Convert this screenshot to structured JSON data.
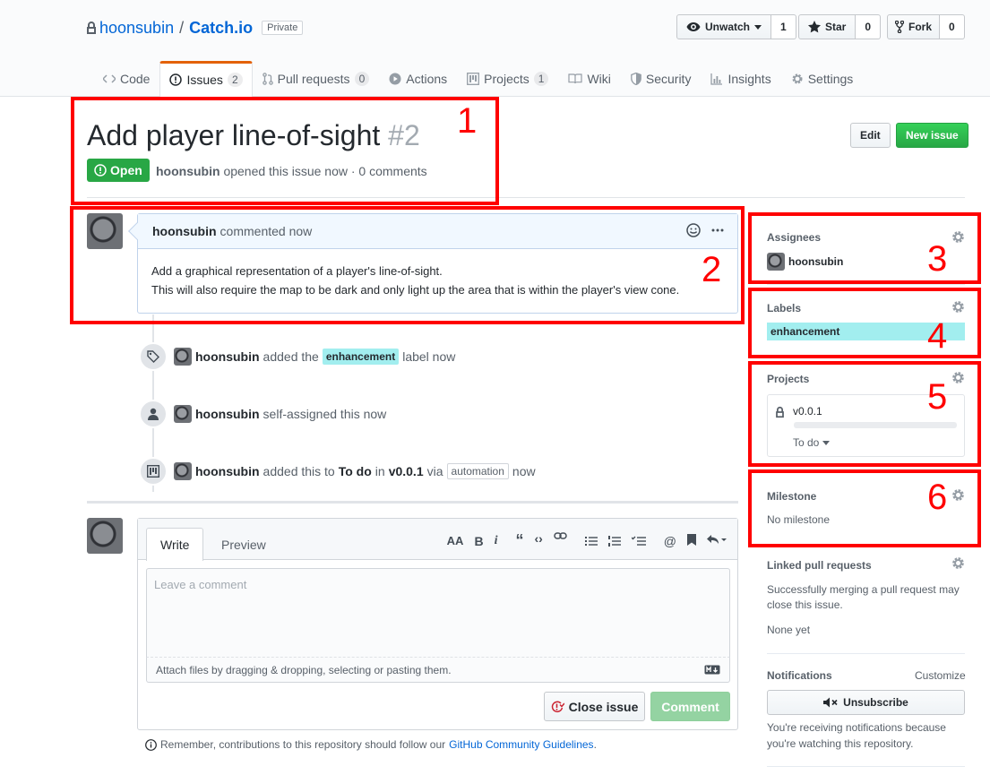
{
  "repo": {
    "owner": "hoonsubin",
    "separator": "/",
    "name": "Catch.io",
    "visibility": "Private"
  },
  "actions": {
    "watch_label": "Unwatch",
    "watch_count": "1",
    "star_label": "Star",
    "star_count": "0",
    "fork_label": "Fork",
    "fork_count": "0"
  },
  "nav": [
    {
      "label": "Code"
    },
    {
      "label": "Issues",
      "count": "2"
    },
    {
      "label": "Pull requests",
      "count": "0"
    },
    {
      "label": "Actions"
    },
    {
      "label": "Projects",
      "count": "1"
    },
    {
      "label": "Wiki"
    },
    {
      "label": "Security"
    },
    {
      "label": "Insights"
    },
    {
      "label": "Settings"
    }
  ],
  "issue": {
    "title": "Add player line-of-sight",
    "number": "#2",
    "state": "Open",
    "author": "hoonsubin",
    "meta": "opened this issue now · 0 comments",
    "edit_label": "Edit",
    "new_issue_label": "New issue"
  },
  "comment": {
    "author": "hoonsubin",
    "time": "commented now",
    "body_line1": "Add a graphical representation of a player's line-of-sight.",
    "body_line2": "This will also require the map to be dark and only light up the area that is within the player's view cone."
  },
  "timeline": {
    "label_event": {
      "actor": "hoonsubin",
      "pre": "added the",
      "label": "enhancement",
      "post": "label now"
    },
    "assign_event": {
      "actor": "hoonsubin",
      "text": "self-assigned this now"
    },
    "project_event": {
      "actor": "hoonsubin",
      "pre": "added this to",
      "column": "To do",
      "mid": "in",
      "project": "v0.0.1",
      "via": "via",
      "badge": "automation",
      "post": "now"
    }
  },
  "form": {
    "tab_write": "Write",
    "tab_preview": "Preview",
    "placeholder": "Leave a comment",
    "attach_text": "Attach files by dragging & dropping, selecting or pasting them.",
    "close_label": "Close issue",
    "comment_label": "Comment",
    "guidelines_pre": "Remember, contributions to this repository should follow our",
    "guidelines_link": "GitHub Community Guidelines",
    "guidelines_post": "."
  },
  "sidebar": {
    "assignees_title": "Assignees",
    "assignee": "hoonsubin",
    "labels_title": "Labels",
    "label": "enhancement",
    "projects_title": "Projects",
    "project_name": "v0.0.1",
    "project_column": "To do",
    "milestone_title": "Milestone",
    "milestone_value": "No milestone",
    "linked_title": "Linked pull requests",
    "linked_desc_1": "Successfully merging a pull request may",
    "linked_desc_2": "close this issue.",
    "linked_value": "None yet",
    "notifications_title": "Notifications",
    "customize_label": "Customize",
    "unsubscribe_label": "Unsubscribe",
    "notif_desc_1": "You're receiving notifications because",
    "notif_desc_2": "you're watching this repository."
  },
  "annotations": [
    "1",
    "2",
    "3",
    "4",
    "5",
    "6"
  ],
  "colors": {
    "annotation": "#ff0000",
    "open": "#28a745",
    "label": "#a2eeef",
    "link": "#0366d6",
    "tab_accent": "#e36209"
  }
}
